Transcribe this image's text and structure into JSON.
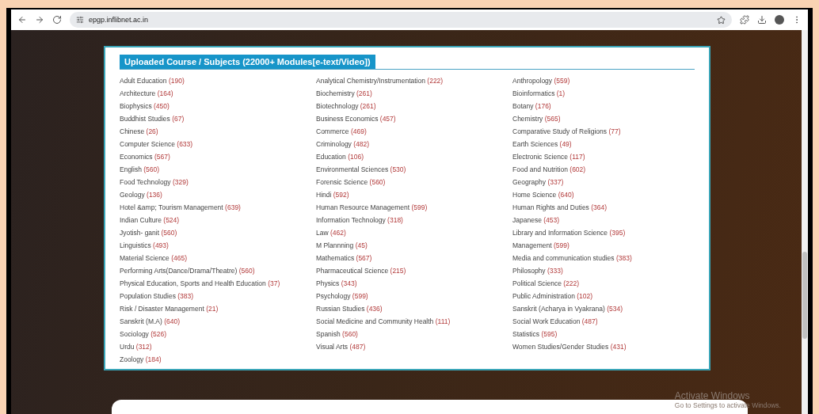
{
  "browser": {
    "url": "epgp.inflibnet.ac.in"
  },
  "panel": {
    "title": "Uploaded Course / Subjects (22000+ Modules[e-text/Video])",
    "columns": [
      [
        {
          "name": "Adult Education",
          "count": "(190)"
        },
        {
          "name": "Architecture",
          "count": "(164)"
        },
        {
          "name": "Biophysics",
          "count": "(450)"
        },
        {
          "name": "Buddhist Studies",
          "count": "(67)"
        },
        {
          "name": "Chinese",
          "count": "(26)"
        },
        {
          "name": "Computer Science",
          "count": "(633)"
        },
        {
          "name": "Economics",
          "count": "(567)"
        },
        {
          "name": "English",
          "count": "(560)"
        },
        {
          "name": "Food Technology",
          "count": "(329)"
        },
        {
          "name": "Geology",
          "count": "(136)"
        },
        {
          "name": "Hotel &amp; Tourism Management",
          "count": "(639)"
        },
        {
          "name": "Indian Culture",
          "count": "(524)"
        },
        {
          "name": "Jyotish- ganit",
          "count": "(560)"
        },
        {
          "name": "Linguistics",
          "count": "(493)"
        },
        {
          "name": "Material Science",
          "count": "(465)"
        },
        {
          "name": "Performing Arts(Dance/Drama/Theatre)",
          "count": "(560)"
        },
        {
          "name": "Physical Education, Sports and Health Education",
          "count": "(37)"
        },
        {
          "name": "Population Studies",
          "count": "(383)"
        },
        {
          "name": "Risk / Disaster Management",
          "count": "(21)"
        },
        {
          "name": "Sanskrit (M.A)",
          "count": "(640)"
        },
        {
          "name": "Sociology",
          "count": "(526)"
        },
        {
          "name": "Urdu",
          "count": "(312)"
        },
        {
          "name": "Zoology",
          "count": "(184)"
        }
      ],
      [
        {
          "name": "Analytical Chemistry/Instrumentation",
          "count": "(222)"
        },
        {
          "name": "Biochemistry",
          "count": "(261)"
        },
        {
          "name": "Biotechnology",
          "count": "(261)"
        },
        {
          "name": "Business Economics",
          "count": "(457)"
        },
        {
          "name": "Commerce",
          "count": "(469)"
        },
        {
          "name": "Criminology",
          "count": "(482)"
        },
        {
          "name": "Education",
          "count": "(106)"
        },
        {
          "name": "Environmental Sciences",
          "count": "(530)"
        },
        {
          "name": "Forensic Science",
          "count": "(560)"
        },
        {
          "name": "Hindi",
          "count": "(592)"
        },
        {
          "name": "Human Resource Management",
          "count": "(599)"
        },
        {
          "name": "Information Technology",
          "count": "(318)"
        },
        {
          "name": "Law",
          "count": "(462)"
        },
        {
          "name": "M Plannning",
          "count": "(45)"
        },
        {
          "name": "Mathematics",
          "count": "(567)"
        },
        {
          "name": "Pharmaceutical Science",
          "count": "(215)"
        },
        {
          "name": "Physics",
          "count": "(343)"
        },
        {
          "name": "Psychology",
          "count": "(599)"
        },
        {
          "name": "Russian Studies",
          "count": "(436)"
        },
        {
          "name": "Social Medicine and Community Health",
          "count": "(111)"
        },
        {
          "name": "Spanish",
          "count": "(560)"
        },
        {
          "name": "Visual Arts",
          "count": "(487)"
        }
      ],
      [
        {
          "name": "Anthropology",
          "count": "(559)"
        },
        {
          "name": "Bioinformatics",
          "count": "(1)"
        },
        {
          "name": "Botany",
          "count": "(176)"
        },
        {
          "name": "Chemistry",
          "count": "(565)"
        },
        {
          "name": "Comparative Study of Religions",
          "count": "(77)"
        },
        {
          "name": "Earth Sciences",
          "count": "(49)"
        },
        {
          "name": "Electronic Science",
          "count": "(117)"
        },
        {
          "name": "Food and Nutrition",
          "count": "(602)"
        },
        {
          "name": "Geography",
          "count": "(337)"
        },
        {
          "name": "Home Science",
          "count": "(640)"
        },
        {
          "name": "Human Rights and Duties",
          "count": "(364)"
        },
        {
          "name": "Japanese",
          "count": "(453)"
        },
        {
          "name": "Library and Information Science",
          "count": "(395)"
        },
        {
          "name": "Management",
          "count": "(599)"
        },
        {
          "name": "Media and communication studies",
          "count": "(383)"
        },
        {
          "name": "Philosophy",
          "count": "(333)"
        },
        {
          "name": "Political Science",
          "count": "(222)"
        },
        {
          "name": "Public Administration",
          "count": "(102)"
        },
        {
          "name": "Sanskrit (Acharya in Vyakrana)",
          "count": "(534)"
        },
        {
          "name": "Social Work Education",
          "count": "(487)"
        },
        {
          "name": "Statistics",
          "count": "(595)"
        },
        {
          "name": "Women Studies/Gender Studies",
          "count": "(431)"
        }
      ]
    ]
  },
  "activation_notice": {
    "title": "Activate Windows",
    "subtitle": "Go to Settings to activate Windows."
  }
}
